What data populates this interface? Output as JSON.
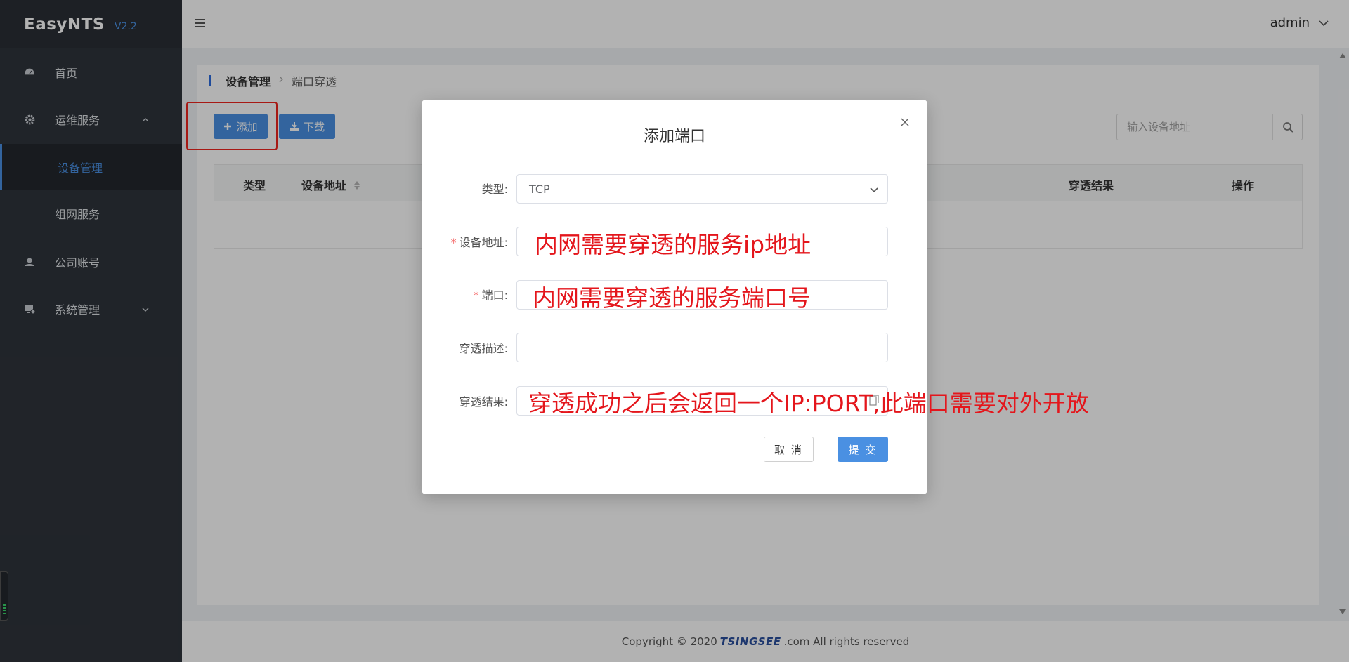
{
  "brand": {
    "name": "EasyNTS",
    "version": "V2.2"
  },
  "sidebar": {
    "items": [
      {
        "label": "首页"
      },
      {
        "label": "运维服务"
      },
      {
        "label": "设备管理"
      },
      {
        "label": "组网服务"
      },
      {
        "label": "公司账号"
      },
      {
        "label": "系统管理"
      }
    ]
  },
  "header": {
    "user": "admin"
  },
  "breadcrumb": {
    "current": "设备管理",
    "sub": "端口穿透"
  },
  "toolbar": {
    "add_label": "添加",
    "download_label": "下载"
  },
  "search": {
    "placeholder": "输入设备地址"
  },
  "table": {
    "columns": [
      "类型",
      "设备地址",
      "穿透结果",
      "操作"
    ]
  },
  "dialog": {
    "title": "添加端口",
    "fields": {
      "type": {
        "label": "类型:",
        "value": "TCP"
      },
      "address": {
        "label": "设备地址:"
      },
      "port": {
        "label": "端口:"
      },
      "desc": {
        "label": "穿透描述:"
      },
      "result": {
        "label": "穿透结果:"
      }
    },
    "cancel_label": "取 消",
    "submit_label": "提 交"
  },
  "annotations": {
    "address": "内网需要穿透的服务ip地址",
    "port": "内网需要穿透的服务端口号",
    "result": "穿透成功之后会返回一个IP:PORT,此端口需要对外开放"
  },
  "footer": {
    "prefix": "Copyright © 2020",
    "brand": "TSINGSEE",
    "suffix": ".com All rights reserved"
  },
  "colors": {
    "primary": "#4a90e2",
    "sidebar": "#2f343b",
    "annotation": "#e4161c",
    "highlight": "#f0241d"
  }
}
